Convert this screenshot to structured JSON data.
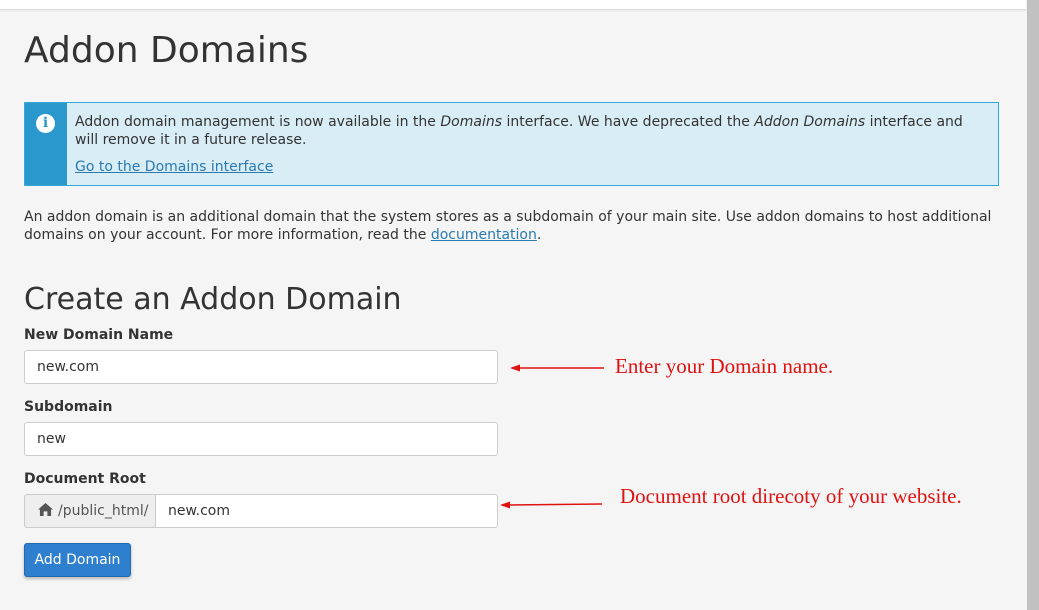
{
  "page": {
    "title": "Addon Domains"
  },
  "alert": {
    "text_1": "Addon domain management is now available in the ",
    "text_em_1": "Domains",
    "text_2": " interface. We have deprecated the ",
    "text_em_2": "Addon Domains",
    "text_3": " interface and will remove it in a future release.",
    "link": "Go to the Domains interface",
    "icon": "info-icon"
  },
  "description": {
    "text": "An addon domain is an additional domain that the system stores as a subdomain of your main site. Use addon domains to host additional domains on your account. For more information, read the ",
    "link": "documentation",
    "end": "."
  },
  "form": {
    "title": "Create an Addon Domain",
    "new_domain_label": "New Domain Name",
    "new_domain_value": "new.com",
    "subdomain_label": "Subdomain",
    "subdomain_value": "new",
    "docroot_label": "Document Root",
    "docroot_prefix": "/public_html/",
    "docroot_value": "new.com",
    "submit_label": "Add Domain"
  },
  "annotations": {
    "domain_note": "Enter your Domain name.",
    "docroot_note": "Document root direcoty of your website."
  },
  "colors": {
    "accent": "#2a98cc",
    "button": "#2f7fcf",
    "annotation": "#e01111"
  }
}
